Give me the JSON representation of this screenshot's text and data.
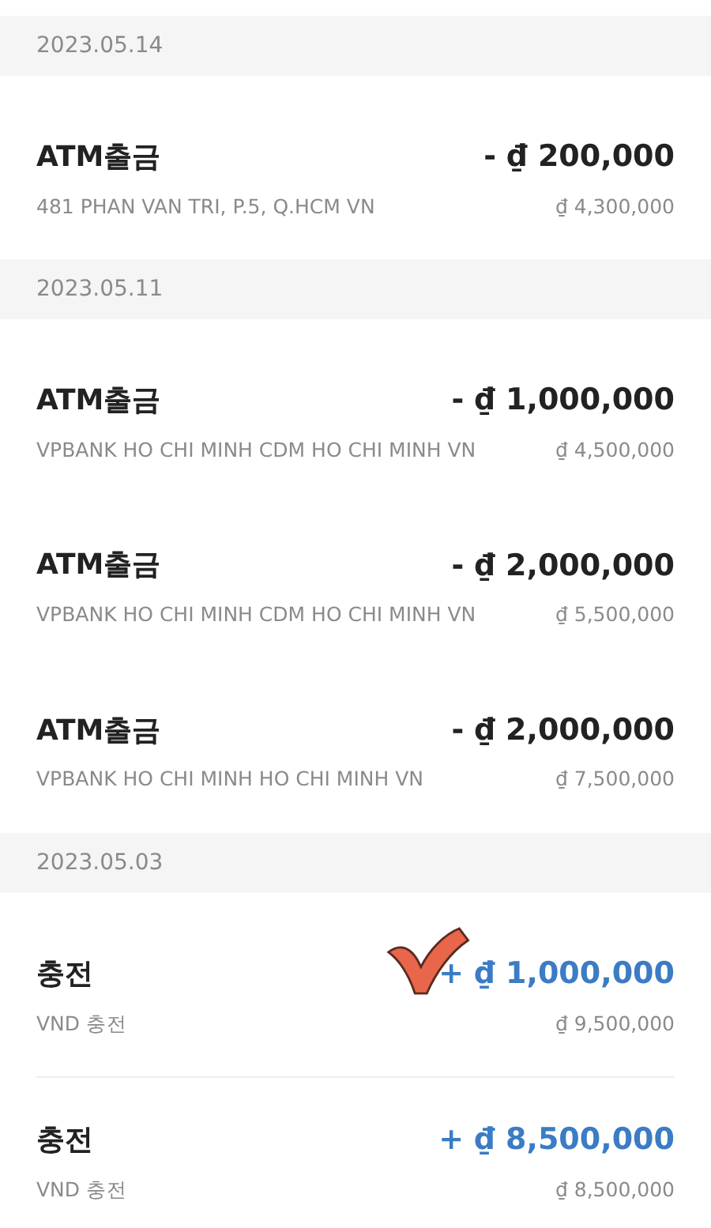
{
  "groups": [
    {
      "date": "2023.05.14",
      "rows": [
        {
          "title": "ATM출금",
          "kind": "debit",
          "amount": "- ₫ 200,000",
          "memo": "481 PHAN VAN TRI, P.5, Q.HCM VN",
          "balance": "₫ 4,300,000",
          "checked": false
        }
      ]
    },
    {
      "date": "2023.05.11",
      "rows": [
        {
          "title": "ATM출금",
          "kind": "debit",
          "amount": "- ₫ 1,000,000",
          "memo": "VPBANK HO CHI MINH CDM HO CHI MINH VN",
          "balance": "₫ 4,500,000",
          "checked": false
        },
        {
          "title": "ATM출금",
          "kind": "debit",
          "amount": "- ₫ 2,000,000",
          "memo": "VPBANK HO CHI MINH CDM HO CHI MINH VN",
          "balance": "₫ 5,500,000",
          "checked": false
        },
        {
          "title": "ATM출금",
          "kind": "debit",
          "amount": "- ₫ 2,000,000",
          "memo": "VPBANK HO CHI MINH HO CHI MINH VN",
          "balance": "₫ 7,500,000",
          "checked": false
        }
      ]
    },
    {
      "date": "2023.05.03",
      "rows": [
        {
          "title": "충전",
          "kind": "credit",
          "amount": "+ ₫ 1,000,000",
          "memo": "VND 충전",
          "balance": "₫ 9,500,000",
          "checked": true
        },
        {
          "title": "충전",
          "kind": "credit",
          "amount": "+ ₫ 8,500,000",
          "memo": "VND 충전",
          "balance": "₫ 8,500,000",
          "checked": false,
          "divider": true
        }
      ]
    }
  ]
}
